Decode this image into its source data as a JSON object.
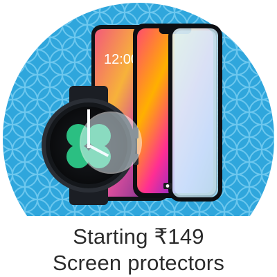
{
  "tile": {
    "price_line": "Starting ₹149",
    "category_line": "Screen protectors",
    "colors": {
      "background_blue": "#2fa6dc",
      "pattern_blue": "#6cc7ee",
      "text": "#2b2b2b"
    },
    "images": {
      "phone_clock": "12:00",
      "phone_icon": "camera-icon",
      "watch_icon": "watch-face-icon"
    }
  }
}
